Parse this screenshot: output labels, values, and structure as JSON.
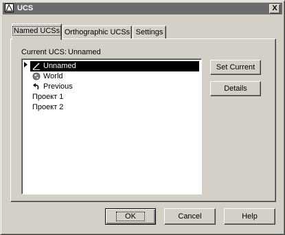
{
  "window": {
    "title": "UCS",
    "close_glyph": "X"
  },
  "tabs": [
    {
      "label": "Named UCSs",
      "active": true
    },
    {
      "label": "Orthographic UCSs",
      "active": false
    },
    {
      "label": "Settings",
      "active": false
    }
  ],
  "named_ucs": {
    "current_label": "Current UCS:",
    "current_value": "Unnamed",
    "items": [
      {
        "label": "Unnamed",
        "icon": "pencil-icon",
        "selected": true
      },
      {
        "label": "World",
        "icon": "globe-icon",
        "selected": false
      },
      {
        "label": "Previous",
        "icon": "undo-arrow-icon",
        "selected": false
      },
      {
        "label": "Проект 1",
        "icon": "",
        "selected": false
      },
      {
        "label": "Проект 2",
        "icon": "",
        "selected": false
      }
    ],
    "set_current_button": "Set Current",
    "details_button": "Details"
  },
  "footer": {
    "ok": "OK",
    "cancel": "Cancel",
    "help": "Help"
  },
  "colors": {
    "titlebar": "#6b6b6b",
    "face": "#d4d0c8",
    "selection": "#000000"
  }
}
